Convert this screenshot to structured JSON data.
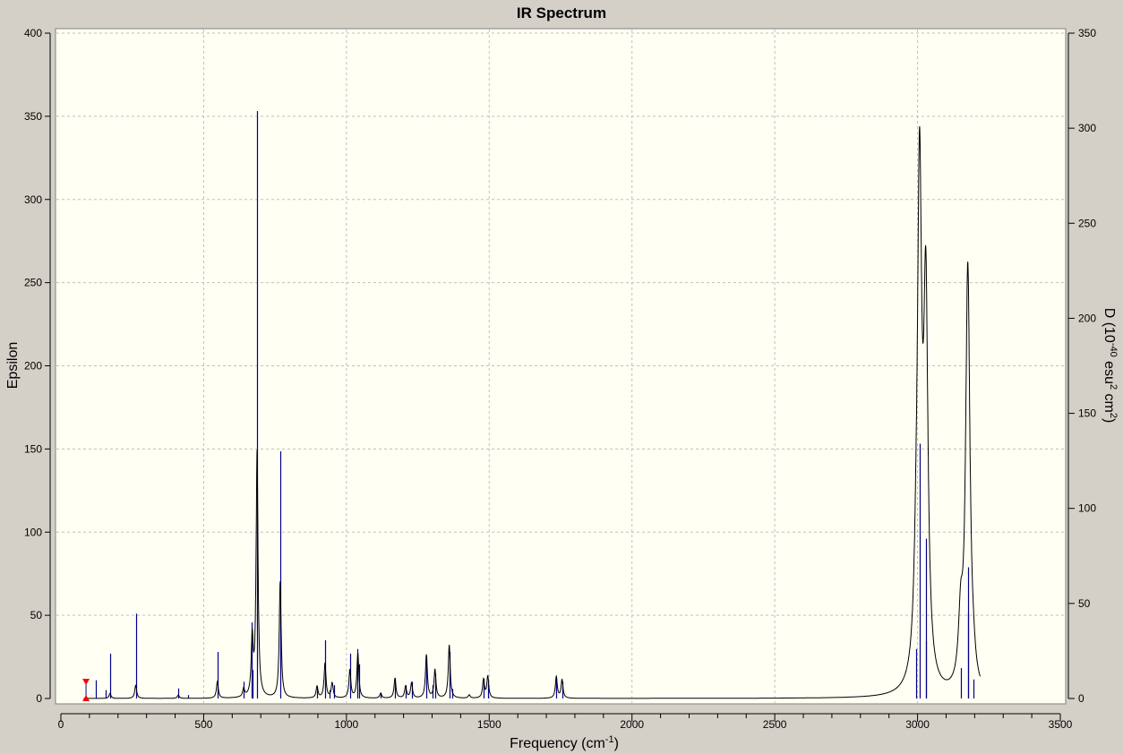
{
  "chart_data": {
    "type": "line",
    "title": "IR Spectrum",
    "xlabel": "Frequency (cm",
    "xlabel_sup": "-1",
    "xlabel_end": ")",
    "ylabel": "Epsilon",
    "y2label_parts": [
      "D (10",
      "-40",
      " esu",
      "2",
      " cm",
      "2",
      ")"
    ],
    "xlim": [
      0,
      3500
    ],
    "ylim": [
      0,
      400
    ],
    "y2lim": [
      0,
      350
    ],
    "xticks": [
      "0",
      "500",
      "1000",
      "1500",
      "2000",
      "2500",
      "3000",
      "3500"
    ],
    "yticks": [
      "0",
      "50",
      "100",
      "150",
      "200",
      "250",
      "300",
      "350",
      "400"
    ],
    "y2ticks": [
      "0",
      "50",
      "100",
      "150",
      "200",
      "250",
      "300",
      "350"
    ],
    "grid": true,
    "curve_color": "#000000",
    "stick_color": "#00008b",
    "marker_color": "#ff0000",
    "marker_frequency": 88,
    "curve_peaks": [
      [
        172,
        3
      ],
      [
        262,
        8
      ],
      [
        411,
        2
      ],
      [
        548,
        10
      ],
      [
        640,
        5
      ],
      [
        670,
        34
      ],
      [
        687,
        148
      ],
      [
        768,
        70
      ],
      [
        897,
        7
      ],
      [
        925,
        21
      ],
      [
        950,
        9
      ],
      [
        1012,
        17
      ],
      [
        1040,
        27
      ],
      [
        1120,
        3
      ],
      [
        1170,
        12
      ],
      [
        1207,
        7
      ],
      [
        1228,
        9
      ],
      [
        1280,
        26
      ],
      [
        1310,
        17
      ],
      [
        1360,
        32
      ],
      [
        1430,
        2
      ],
      [
        1480,
        11
      ],
      [
        1495,
        13
      ],
      [
        1735,
        13
      ],
      [
        1755,
        11
      ],
      [
        2995,
        30
      ],
      [
        3007,
        300
      ],
      [
        3029,
        225
      ],
      [
        3151,
        38
      ],
      [
        3176,
        255
      ],
      [
        3195,
        8
      ]
    ],
    "sticks_D": [
      [
        122,
        9.6
      ],
      [
        157,
        4.4
      ],
      [
        172,
        23.6
      ],
      [
        262,
        44.6
      ],
      [
        411,
        5.3
      ],
      [
        445,
        1.8
      ],
      [
        548,
        24.5
      ],
      [
        640,
        8.8
      ],
      [
        668,
        40
      ],
      [
        671,
        15
      ],
      [
        687,
        309
      ],
      [
        768,
        130
      ],
      [
        897,
        6
      ],
      [
        925,
        30.6
      ],
      [
        940,
        4.4
      ],
      [
        955,
        7
      ],
      [
        1012,
        23.6
      ],
      [
        1038,
        26
      ],
      [
        1045,
        18
      ],
      [
        1120,
        3
      ],
      [
        1170,
        10.5
      ],
      [
        1207,
        7
      ],
      [
        1228,
        8.8
      ],
      [
        1280,
        22
      ],
      [
        1300,
        7
      ],
      [
        1310,
        13
      ],
      [
        1360,
        24.5
      ],
      [
        1370,
        5
      ],
      [
        1480,
        10.5
      ],
      [
        1495,
        8.8
      ],
      [
        1735,
        10.5
      ],
      [
        1755,
        8.8
      ],
      [
        2995,
        26
      ],
      [
        3007,
        134
      ],
      [
        3029,
        84
      ],
      [
        3030,
        30
      ],
      [
        3151,
        16
      ],
      [
        3176,
        69
      ],
      [
        3178,
        45
      ],
      [
        3195,
        10
      ]
    ]
  }
}
